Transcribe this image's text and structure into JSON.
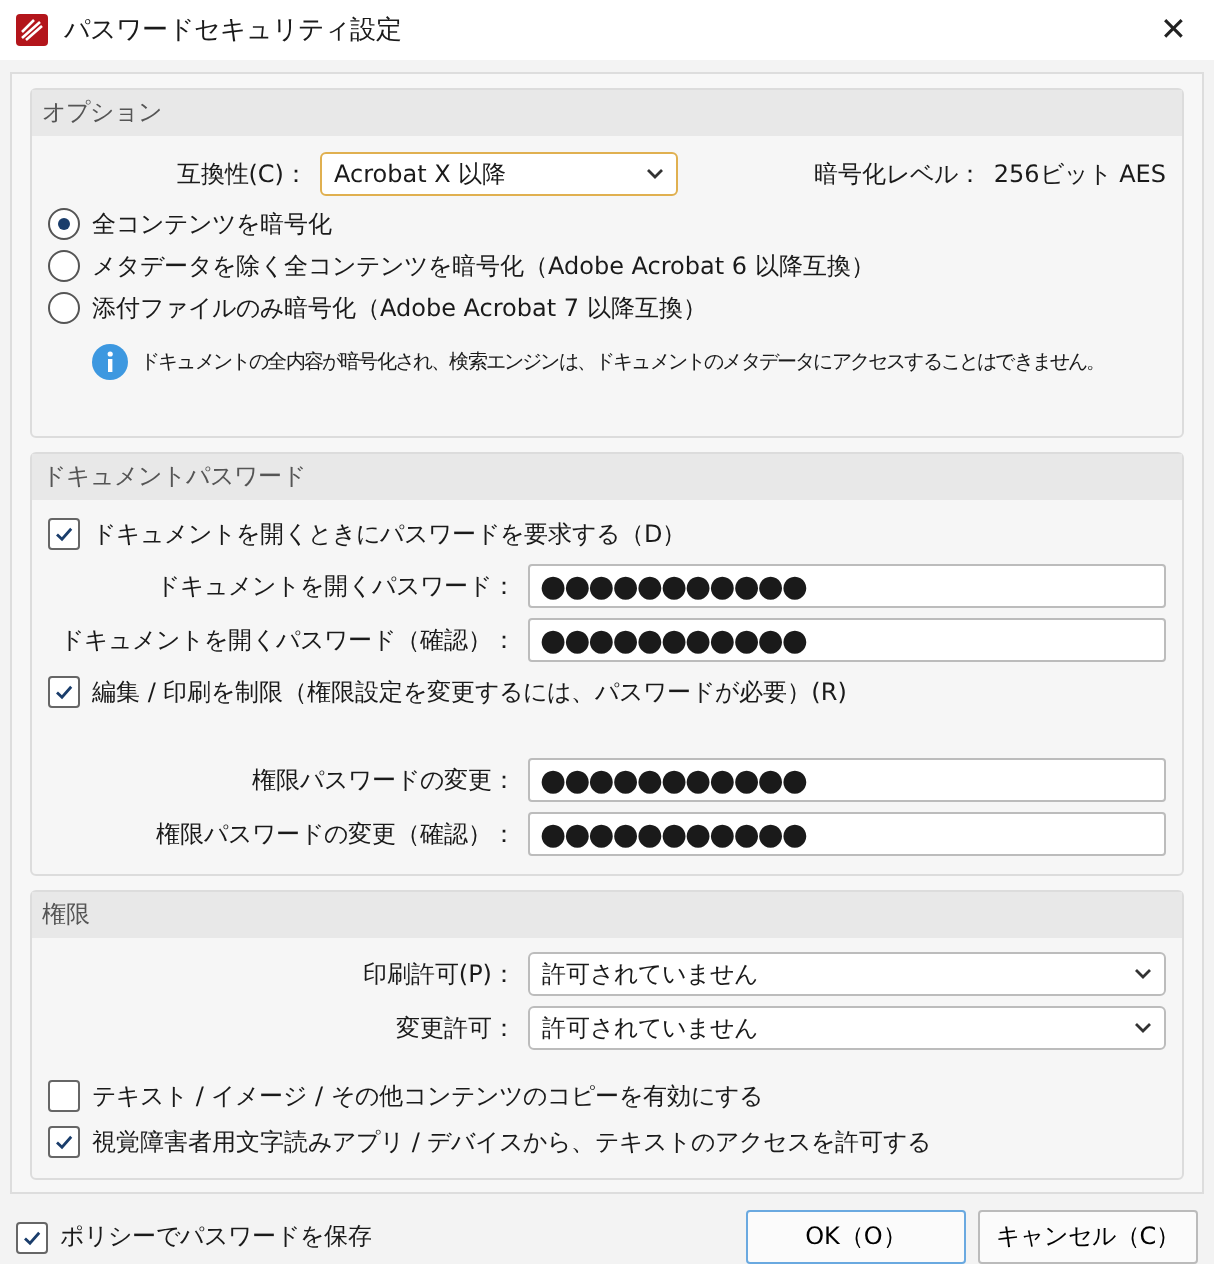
{
  "window": {
    "title": "パスワードセキュリティ設定",
    "close": "✕"
  },
  "options": {
    "title": "オプション",
    "compat_label": "互換性(C)：",
    "compat_value": "Acrobat X 以降",
    "level_label": "暗号化レベル：",
    "level_value": "256ビット AES",
    "radios": [
      {
        "label": "全コンテンツを暗号化",
        "selected": true
      },
      {
        "label": "メタデータを除く全コンテンツを暗号化（Adobe Acrobat 6 以降互換）",
        "selected": false
      },
      {
        "label": "添付ファイルのみ暗号化（Adobe Acrobat 7 以降互換）",
        "selected": false
      }
    ],
    "info": "ドキュメントの全内容が暗号化され、検索エンジンは、ドキュメントのメタデータにアクセスすることはできません。"
  },
  "document_password": {
    "title": "ドキュメントパスワード",
    "groups": [
      {
        "label": "ドキュメントを開くときにパスワードを要求する（D）",
        "checked": true,
        "fields": [
          {
            "label": "ドキュメントを開くパスワード：",
            "value": "●●●●●●●●●●●"
          },
          {
            "label": "ドキュメントを開くパスワード（確認）：",
            "value": "●●●●●●●●●●●"
          }
        ]
      },
      {
        "label": "編集 / 印刷を制限（権限設定を変更するには、パスワードが必要）(R)",
        "checked": true,
        "fields": [
          {
            "label": "権限パスワードの変更：",
            "value": "●●●●●●●●●●●"
          },
          {
            "label": "権限パスワードの変更（確認）：",
            "value": "●●●●●●●●●●●"
          }
        ]
      }
    ]
  },
  "permissions": {
    "title": "権限",
    "selects": [
      {
        "label": "印刷許可(P)：",
        "value": "許可されていません"
      },
      {
        "label": "変更許可：",
        "value": "許可されていません"
      }
    ],
    "checks": [
      {
        "label": "テキスト / イメージ / その他コンテンツのコピーを有効にする",
        "checked": false
      },
      {
        "label": "視覚障害者用文字読みアプリ / デバイスから、テキストのアクセスを許可する",
        "checked": true
      }
    ]
  },
  "footer": {
    "policy": {
      "label": "ポリシーでパスワードを保存",
      "checked": true
    },
    "buttons": [
      {
        "label": "OK（O）",
        "primary": true
      },
      {
        "label": "キャンセル（C）",
        "primary": false
      }
    ]
  }
}
